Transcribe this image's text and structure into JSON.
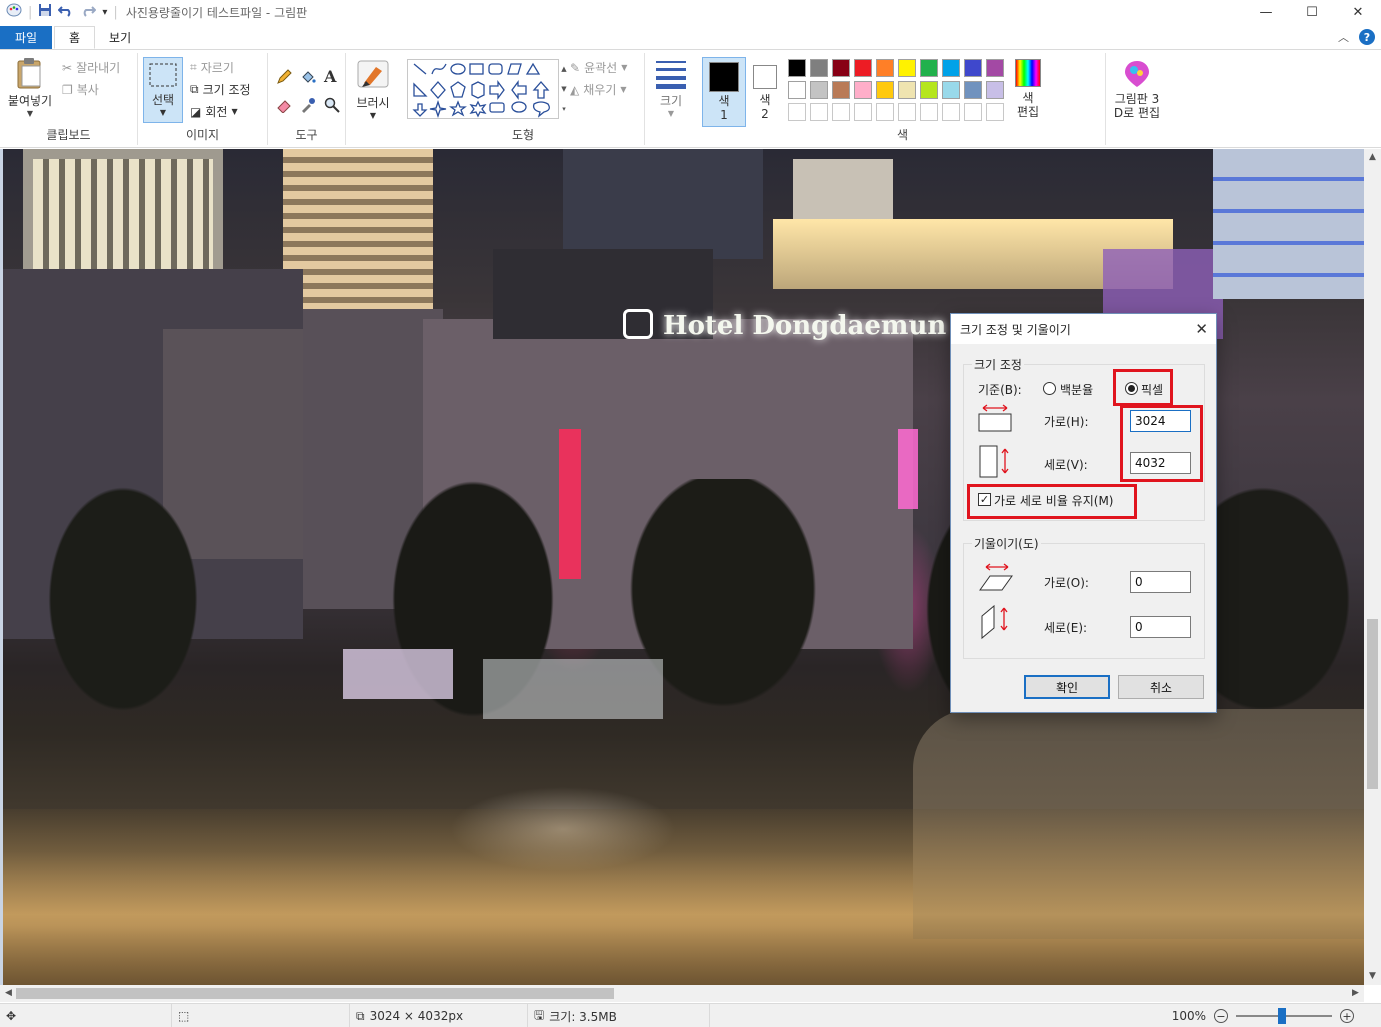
{
  "window": {
    "title": "사진용량줄이기 테스트파일 - 그림판",
    "minimize_glyph": "—",
    "maximize_glyph": "☐",
    "close_glyph": "✕"
  },
  "ribbon_tabs": {
    "file": "파일",
    "home": "홈",
    "view": "보기"
  },
  "clipboard": {
    "paste": "붙여넣기",
    "cut": "잘라내기",
    "copy": "복사",
    "group_label": "클립보드"
  },
  "image": {
    "select": "선택",
    "crop": "자르기",
    "resize": "크기 조정",
    "rotate": "회전",
    "group_label": "이미지"
  },
  "tools": {
    "brush": "브러시",
    "group_label": "도구"
  },
  "shapes": {
    "outline": "윤곽선",
    "fill": "채우기",
    "group_label": "도형"
  },
  "size": {
    "label": "크기"
  },
  "colors": {
    "color1": "색\n1",
    "color2": "색\n2",
    "edit": "색\n편집",
    "group_label": "색",
    "paint3d": "그림판 3\nD로 편집",
    "palette_row1": [
      "#000000",
      "#7f7f7f",
      "#880015",
      "#ed1c24",
      "#ff7f27",
      "#fff200",
      "#22b14c",
      "#00a2e8",
      "#3f48cc",
      "#a349a4"
    ],
    "palette_row2": [
      "#ffffff",
      "#c3c3c3",
      "#b97a57",
      "#ffaec9",
      "#ffc90e",
      "#efe4b0",
      "#b5e61d",
      "#99d9ea",
      "#7092be",
      "#c8bfe7"
    ]
  },
  "canvas": {
    "sign_text": "Hotel Dongdaemun"
  },
  "dialog": {
    "title": "크기 조정 및 기울이기",
    "resize_legend": "크기 조정",
    "basis_label": "기준(B):",
    "percent_label": "백분율",
    "pixel_label": "픽셀",
    "horizontal_label": "가로(H):",
    "horizontal_value": "3024",
    "vertical_label": "세로(V):",
    "vertical_value": "4032",
    "keep_ratio_label": "가로 세로 비율 유지(M)",
    "skew_legend": "기울이기(도)",
    "skew_h_label": "가로(O):",
    "skew_h_value": "0",
    "skew_v_label": "세로(E):",
    "skew_v_value": "0",
    "ok": "확인",
    "cancel": "취소"
  },
  "status": {
    "dimensions": "3024 × 4032px",
    "filesize": "크기: 3.5MB",
    "zoom": "100%"
  }
}
